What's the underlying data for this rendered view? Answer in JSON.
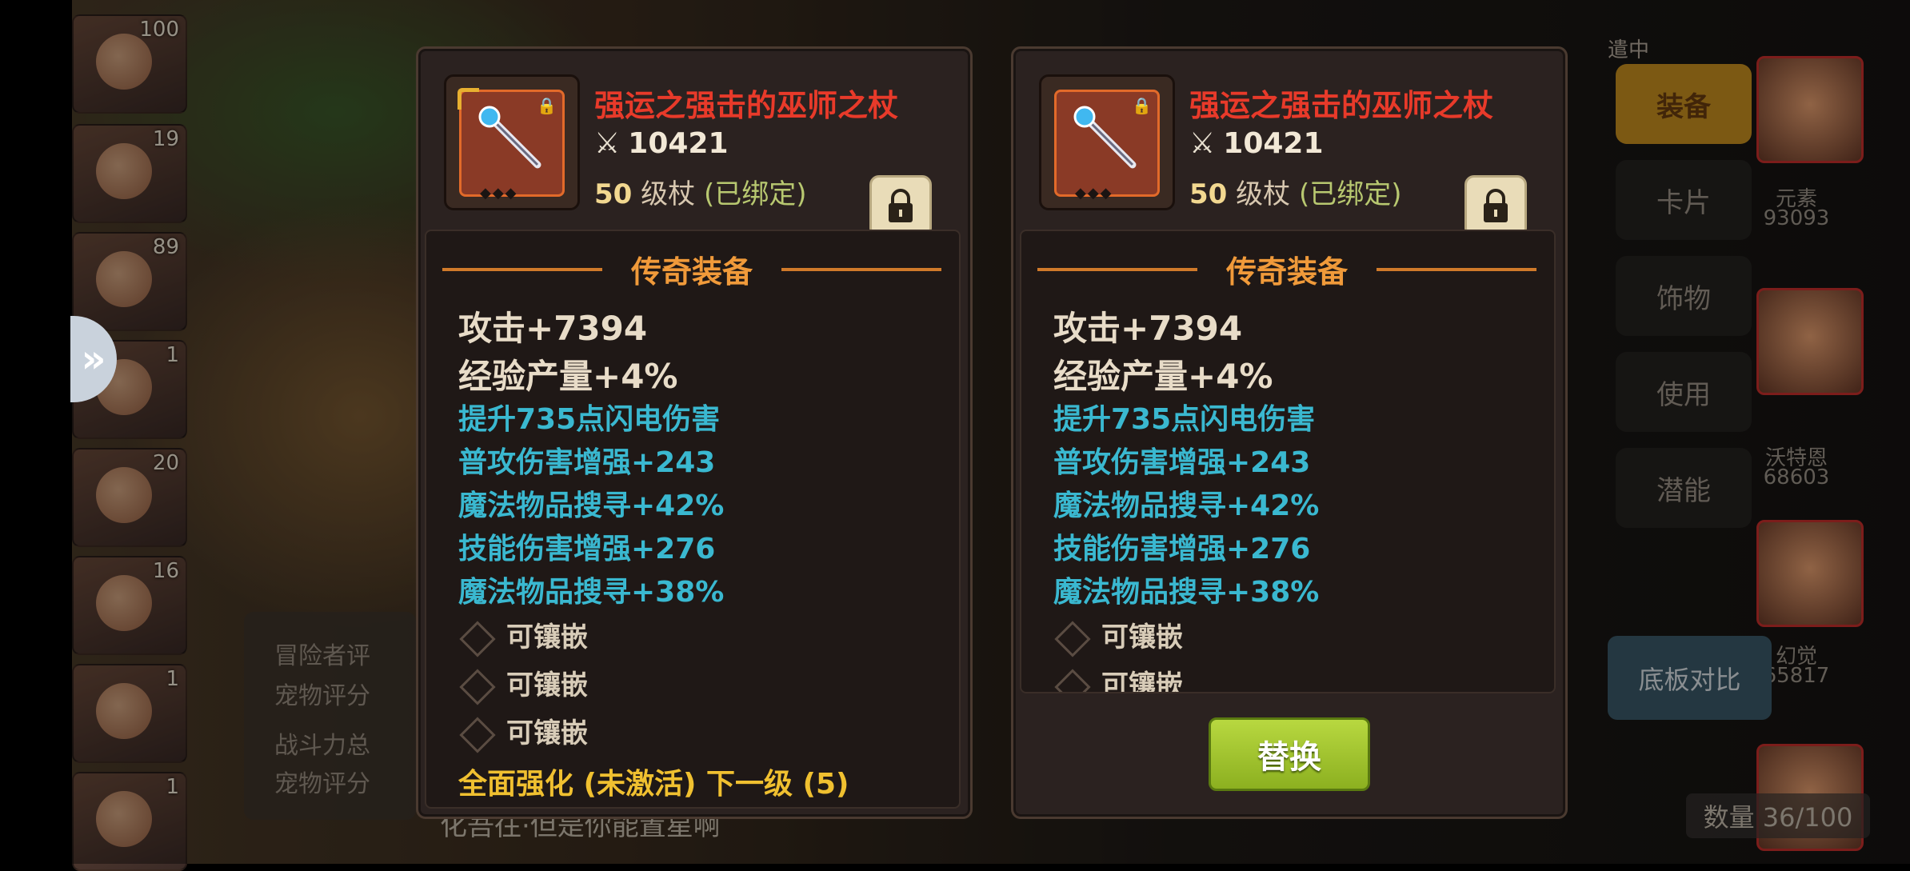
{
  "background": {
    "portraits": [
      {
        "level": "100"
      },
      {
        "level": "19"
      },
      {
        "level": "89"
      },
      {
        "level": "1"
      },
      {
        "level": "20"
      },
      {
        "level": "16"
      },
      {
        "level": "1"
      },
      {
        "level": "1"
      }
    ],
    "info_lines": [
      "冒险者评",
      "宠物评分",
      "战斗力总",
      "宠物评分"
    ],
    "footer_text": "化吾往·但是你能置星啊",
    "equip_tag": "遣中",
    "menu": [
      "装备",
      "卡片",
      "饰物",
      "使用",
      "潜能"
    ],
    "compare_button": "底板对比",
    "count_label": "数量 36/100",
    "heroes": [
      {
        "name": "元素",
        "power": "93093"
      },
      {
        "name": "沃特恩",
        "power": "68603"
      },
      {
        "name": "幻觉",
        "power": "65817"
      }
    ]
  },
  "tooltips": [
    {
      "item_name": "强运之强击的巫师之杖",
      "power": "10421",
      "level_num": "50",
      "level_type": "级杖",
      "bound": "(已绑定)",
      "rarity": "传奇装备",
      "main_stats": [
        "攻击+7394",
        "经验产量+4%"
      ],
      "sub_stats": [
        "提升735点闪电伤害",
        "普攻伤害增强+243",
        "魔法物品搜寻+42%",
        "技能伤害增强+276",
        "魔法物品搜寻+38%"
      ],
      "sockets": [
        "可镶嵌",
        "可镶嵌",
        "可镶嵌"
      ],
      "set_bonus": "全面强化 (未激活) 下一级 (5)"
    },
    {
      "item_name": "强运之强击的巫师之杖",
      "power": "10421",
      "level_num": "50",
      "level_type": "级杖",
      "bound": "(已绑定)",
      "rarity": "传奇装备",
      "main_stats": [
        "攻击+7394",
        "经验产量+4%"
      ],
      "sub_stats": [
        "提升735点闪电伤害",
        "普攻伤害增强+243",
        "魔法物品搜寻+42%",
        "技能伤害增强+276",
        "魔法物品搜寻+38%"
      ],
      "sockets": [
        "可镶嵌",
        "可镶嵌"
      ],
      "replace_button": "替换"
    }
  ],
  "colors": {
    "item_name": "#e83a2a",
    "rarity": "#f09a3a",
    "sub_stat": "#3ab8d0",
    "set_bonus": "#f0c030",
    "replace_button": "#a4c830"
  },
  "icons": [
    "staff-icon",
    "crossed-swords-icon",
    "lock-icon",
    "chevron-right-icon"
  ]
}
